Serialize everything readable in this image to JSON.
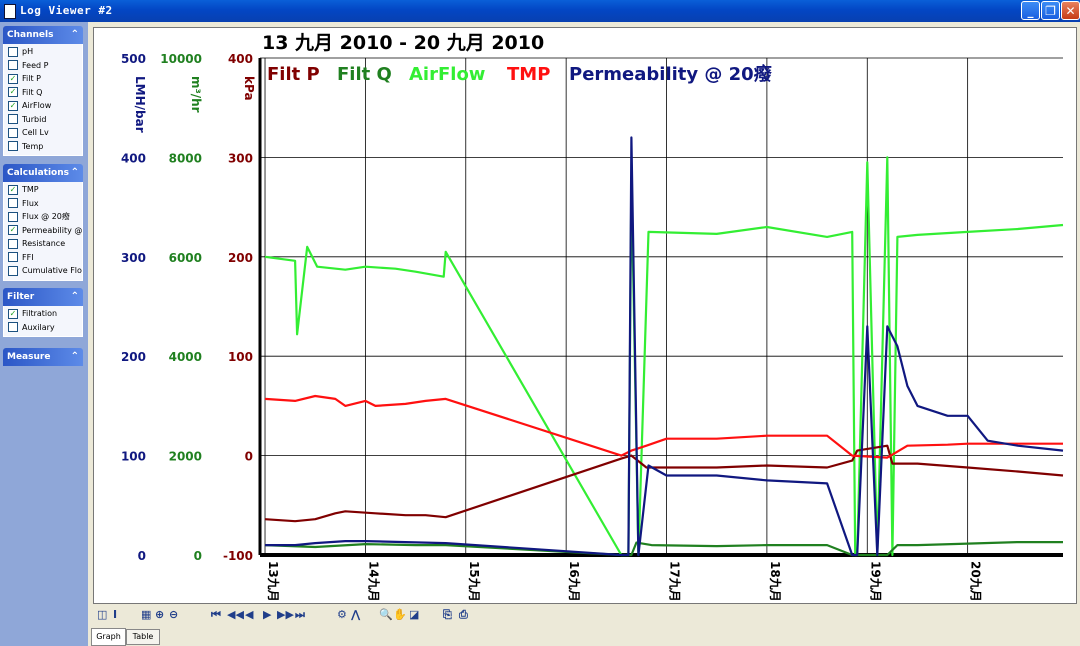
{
  "window": {
    "title": "Log Viewer #2"
  },
  "sidebar": {
    "channels": {
      "title": "Channels",
      "items": [
        {
          "label": "pH",
          "checked": false
        },
        {
          "label": "Feed P",
          "checked": false
        },
        {
          "label": "Filt P",
          "checked": true
        },
        {
          "label": "Filt Q",
          "checked": true
        },
        {
          "label": "AirFlow",
          "checked": true
        },
        {
          "label": "Turbid",
          "checked": false
        },
        {
          "label": "Cell Lv",
          "checked": false
        },
        {
          "label": "Temp",
          "checked": false
        }
      ]
    },
    "calculations": {
      "title": "Calculations",
      "items": [
        {
          "label": "TMP",
          "checked": true
        },
        {
          "label": "Flux",
          "checked": false
        },
        {
          "label": "Flux @ 20癈",
          "checked": false
        },
        {
          "label": "Permeability @",
          "checked": true
        },
        {
          "label": "Resistance",
          "checked": false
        },
        {
          "label": "FFI",
          "checked": false
        },
        {
          "label": "Cumulative Flo",
          "checked": false
        }
      ]
    },
    "filter": {
      "title": "Filter",
      "items": [
        {
          "label": "Filtration",
          "checked": true
        },
        {
          "label": "Auxilary",
          "checked": false
        }
      ]
    },
    "measure": {
      "title": "Measure"
    }
  },
  "graph": {
    "title": "13 九月 2010 - 20 九月 2010",
    "legend": [
      {
        "label": "Filt P",
        "color": "#800000"
      },
      {
        "label": "Filt Q",
        "color": "#208020"
      },
      {
        "label": "AirFlow",
        "color": "#33ee33"
      },
      {
        "label": "TMP",
        "color": "#ff1010"
      },
      {
        "label": "Permeability @ 20癈",
        "color": "#101880"
      }
    ],
    "axes": [
      {
        "unit": "LMH/bar",
        "color": "#101880",
        "ticks": [
          "500",
          "400",
          "300",
          "200",
          "100",
          "0"
        ]
      },
      {
        "unit": "m³/hr",
        "color": "#208020",
        "ticks": [
          "10000",
          "8000",
          "6000",
          "4000",
          "2000",
          "0"
        ]
      },
      {
        "unit": "kPa",
        "color": "#800000",
        "ticks": [
          "400",
          "300",
          "200",
          "100",
          "0",
          "-100"
        ]
      }
    ],
    "x_ticks": [
      "13九月",
      "14九月",
      "15九月",
      "16九月",
      "17九月",
      "18九月",
      "19九月",
      "20九月"
    ]
  },
  "chart_data": {
    "type": "line",
    "title": "13 九月 2010 - 20 九月 2010",
    "x_unit": "days (13 九月 = 0)",
    "xlim": [
      -0.05,
      7.95
    ],
    "y_axes": [
      {
        "label": "LMH/bar",
        "ylim": [
          0,
          500
        ]
      },
      {
        "label": "m³/hr",
        "ylim": [
          0,
          10000
        ]
      },
      {
        "label": "kPa",
        "ylim": [
          -100,
          400
        ]
      }
    ],
    "grid": true,
    "series": [
      {
        "name": "AirFlow",
        "axis": "kPa",
        "color": "#33ee33",
        "x": [
          0,
          0.3,
          0.32,
          0.42,
          0.52,
          0.8,
          1.0,
          1.3,
          1.5,
          1.78,
          1.8,
          3.55,
          3.62,
          3.65,
          3.72,
          3.82,
          4.5,
          5.0,
          5.6,
          5.85,
          5.88,
          5.9,
          6.0,
          6.1,
          6.2,
          6.25,
          6.3,
          6.5,
          7.0,
          7.5,
          7.95
        ],
        "y": [
          200,
          196,
          122,
          210,
          190,
          187,
          190,
          188,
          185,
          180,
          205,
          -100,
          -100,
          280,
          -100,
          225,
          223,
          230,
          220,
          225,
          -100,
          -100,
          295,
          -100,
          300,
          -100,
          220,
          222,
          225,
          228,
          232
        ]
      },
      {
        "name": "Filt P",
        "axis": "kPa",
        "color": "#800000",
        "x": [
          0,
          0.3,
          0.5,
          0.7,
          0.8,
          1.1,
          1.4,
          1.6,
          1.8,
          3.55,
          3.65,
          3.8,
          4.0,
          4.5,
          5.0,
          5.6,
          5.85,
          5.9,
          6.2,
          6.25,
          6.5,
          7.0,
          7.5,
          7.95
        ],
        "y": [
          -64,
          -66,
          -64,
          -58,
          -56,
          -58,
          -60,
          -60,
          -62,
          -3,
          0,
          -12,
          -12,
          -12,
          -10,
          -12,
          -5,
          5,
          10,
          -8,
          -8,
          -12,
          -16,
          -20
        ]
      },
      {
        "name": "Filt Q",
        "axis": "m³/hr",
        "color": "#208020",
        "x": [
          0,
          0.5,
          1.0,
          1.5,
          1.8,
          3.55,
          3.65,
          3.7,
          3.85,
          4.5,
          5.0,
          5.6,
          5.85,
          6.2,
          6.3,
          6.5,
          7.0,
          7.5,
          7.95
        ],
        "y": [
          200,
          160,
          220,
          200,
          200,
          0,
          0,
          250,
          200,
          180,
          200,
          200,
          0,
          0,
          200,
          200,
          230,
          260,
          260
        ]
      },
      {
        "name": "TMP",
        "axis": "kPa",
        "color": "#ff1010",
        "x": [
          0,
          0.3,
          0.5,
          0.7,
          0.8,
          1.0,
          1.1,
          1.4,
          1.6,
          1.8,
          3.55,
          3.65,
          3.8,
          4.0,
          4.5,
          5.0,
          5.6,
          5.85,
          6.2,
          6.4,
          6.8,
          7.0,
          7.5,
          7.95
        ],
        "y": [
          57,
          55,
          60,
          57,
          50,
          55,
          50,
          52,
          55,
          57,
          0,
          5,
          10,
          17,
          17,
          20,
          20,
          0,
          -2,
          10,
          11,
          12,
          12,
          12
        ]
      },
      {
        "name": "Permeability @ 20癈",
        "axis": "LMH/bar",
        "color": "#101880",
        "x": [
          0,
          0.3,
          0.5,
          0.8,
          1.0,
          1.4,
          1.8,
          3.55,
          3.62,
          3.65,
          3.72,
          3.82,
          4.0,
          4.5,
          5.0,
          5.6,
          5.85,
          5.9,
          6.0,
          6.1,
          6.2,
          6.3,
          6.4,
          6.5,
          6.8,
          7.0,
          7.2,
          7.5,
          7.95
        ],
        "y": [
          10,
          10,
          12,
          14,
          14,
          13,
          12,
          0,
          0,
          420,
          0,
          90,
          80,
          80,
          75,
          72,
          0,
          0,
          230,
          0,
          230,
          210,
          170,
          150,
          140,
          140,
          115,
          110,
          105
        ]
      }
    ]
  },
  "toolbar": {
    "buttons": [
      {
        "glyph": "◫",
        "name": "layout-icon"
      },
      {
        "glyph": "I",
        "name": "cursor-icon"
      },
      {
        "glyph": "▦",
        "name": "grid-icon"
      },
      {
        "glyph": "⊕",
        "name": "zoom-in-icon"
      },
      {
        "glyph": "⊖",
        "name": "zoom-out-icon"
      },
      {
        "glyph": "⏮",
        "name": "first-icon"
      },
      {
        "glyph": "◀◀",
        "name": "rewind-icon"
      },
      {
        "glyph": "◀",
        "name": "prev-icon"
      },
      {
        "glyph": "▶",
        "name": "next-icon"
      },
      {
        "glyph": "▶▶",
        "name": "forward-icon"
      },
      {
        "glyph": "⏭",
        "name": "last-icon"
      },
      {
        "glyph": "⚙",
        "name": "settings-icon"
      },
      {
        "glyph": "⋀",
        "name": "peak-icon"
      },
      {
        "glyph": "🔍",
        "name": "search-icon"
      },
      {
        "glyph": "✋",
        "name": "pan-icon"
      },
      {
        "glyph": "◪",
        "name": "measure-icon"
      },
      {
        "glyph": "⎘",
        "name": "copy-icon"
      },
      {
        "glyph": "⎙",
        "name": "print-icon"
      }
    ]
  },
  "tabs": {
    "graph": "Graph",
    "table": "Table"
  }
}
